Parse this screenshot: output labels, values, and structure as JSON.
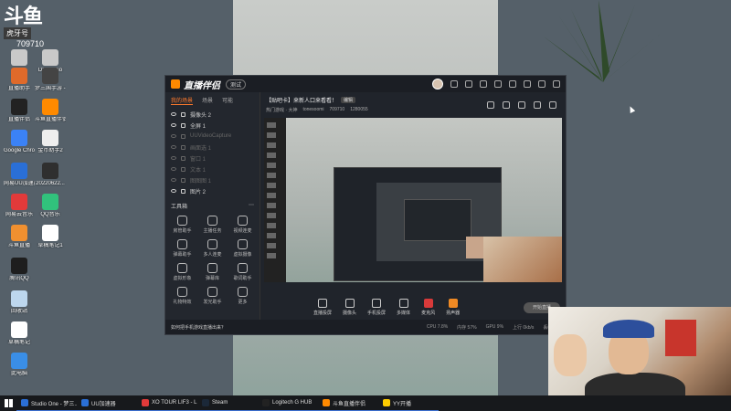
{
  "desktop": {
    "logo": {
      "text": "斗鱼",
      "tag": "虎牙号",
      "number": "709710"
    },
    "icons": [
      {
        "label": "图标",
        "color": "#c9c9c9"
      },
      {
        "label": "DL Studio",
        "color": "#c9c9c9"
      },
      {
        "label": "直播助手",
        "color": "#e06a2a"
      },
      {
        "label": "梦三国手游 - 11",
        "color": "#444444"
      },
      {
        "label": "直播伴侣",
        "color": "#222222"
      },
      {
        "label": "斗鱼直播伴侣",
        "color": "#ff8a00"
      },
      {
        "label": "Google Chrome",
        "color": "#3b82f6"
      },
      {
        "label": "金币助手2",
        "color": "#eeeeee"
      },
      {
        "label": "网易UU加速器",
        "color": "#2a6fd6"
      },
      {
        "label": "20220622...",
        "color": "#2f2f2f"
      },
      {
        "label": "网易云音乐",
        "color": "#e23a3a"
      },
      {
        "label": "QQ音乐",
        "color": "#31c27c"
      },
      {
        "label": "斗鱼直播",
        "color": "#f09030"
      },
      {
        "label": "草稿笔记1",
        "color": "#ffffff"
      },
      {
        "label": "腾讯QQ",
        "color": "#1e1e1e"
      },
      {
        "label": "回收站",
        "color": "#bdd7ee"
      },
      {
        "label": "草稿笔记",
        "color": "#ffffff"
      },
      {
        "label": "此电脑",
        "color": "#3a8ee6"
      }
    ]
  },
  "window": {
    "app_name": "直播伴侣",
    "version": "测试",
    "left_tabs": [
      "我的场景",
      "场景",
      "可能"
    ],
    "scenes": [
      {
        "label": "摄像头 2",
        "dim": false
      },
      {
        "label": "全屏 1",
        "dim": false
      },
      {
        "label": "UUVideoCapture",
        "dim": true
      },
      {
        "label": "画面选 1",
        "dim": true
      },
      {
        "label": "窗口 1",
        "dim": true
      },
      {
        "label": "文本 1",
        "dim": true
      },
      {
        "label": "图图图 1",
        "dim": true
      },
      {
        "label": "图片 2",
        "dim": false
      }
    ],
    "tools_title": "工具箱",
    "tools": [
      "房管助手",
      "主播任务",
      "视频连麦",
      "弹幕助手",
      "多人连麦",
      "虚拟摄像",
      "虚拟形象",
      "弹幕库",
      "歌词助手",
      "礼物特效",
      "发光助手",
      "更多"
    ],
    "room_title": "【贴吧卡】来新人口来看看！",
    "edit_label": "编辑",
    "room_info": [
      "热门游戏 · 大神",
      "tonesoomi",
      "709710",
      "1280055"
    ],
    "bottom_tools": [
      {
        "label": "直播投屏",
        "style": ""
      },
      {
        "label": "摄像头",
        "style": ""
      },
      {
        "label": "手机投屏",
        "style": ""
      },
      {
        "label": "多媒体",
        "style": ""
      },
      {
        "label": "麦克风",
        "style": "red"
      },
      {
        "label": "扬声器",
        "style": "orange"
      }
    ],
    "start_live": "开始直播",
    "status_tip": "如何把手机游戏直播出来？",
    "status_items": [
      "CPU 7.8%",
      "内存 57%",
      "GPU 9%",
      "上行 0kb/s",
      "丢帧 0%"
    ]
  },
  "taskbar": {
    "items": [
      {
        "label": "Studio One - 梦三...",
        "color": "#2b6fd6"
      },
      {
        "label": "UU加速器",
        "color": "#2a6fd6"
      },
      {
        "label": "XO TOUR LIF3 - L...",
        "color": "#e23a3a"
      },
      {
        "label": "Steam",
        "color": "#1b2838"
      },
      {
        "label": "Logitech G HUB",
        "color": "#222222"
      },
      {
        "label": "斗鱼直播伴侣",
        "color": "#ff8a00"
      },
      {
        "label": "YY开播",
        "color": "#ffcc00"
      }
    ]
  }
}
